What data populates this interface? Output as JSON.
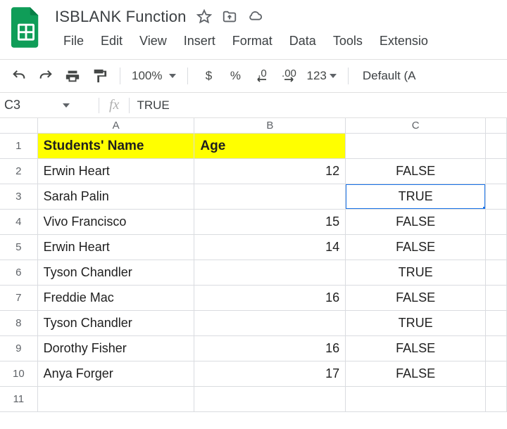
{
  "doc": {
    "title": "ISBLANK Function"
  },
  "menu": {
    "file": "File",
    "edit": "Edit",
    "view": "View",
    "insert": "Insert",
    "format": "Format",
    "data": "Data",
    "tools": "Tools",
    "extensions": "Extensio"
  },
  "toolbar": {
    "zoom": "100%",
    "currency": "$",
    "percent": "%",
    "dec_dec": ".0",
    "dec_inc": ".00",
    "numfmt": "123",
    "font": "Default (A"
  },
  "namebox": {
    "ref": "C3"
  },
  "formula": {
    "value": "TRUE"
  },
  "columns": {
    "A": "A",
    "B": "B",
    "C": "C"
  },
  "headers": {
    "col_a": "Students' Name",
    "col_b": "Age"
  },
  "rows": [
    {
      "n": "1"
    },
    {
      "n": "2",
      "name": "Erwin Heart",
      "age": "12",
      "result": "FALSE"
    },
    {
      "n": "3",
      "name": "Sarah Palin",
      "age": "",
      "result": "TRUE"
    },
    {
      "n": "4",
      "name": "Vivo Francisco",
      "age": "15",
      "result": "FALSE"
    },
    {
      "n": "5",
      "name": "Erwin Heart",
      "age": "14",
      "result": "FALSE"
    },
    {
      "n": "6",
      "name": "Tyson Chandler",
      "age": "",
      "result": "TRUE"
    },
    {
      "n": "7",
      "name": "Freddie Mac",
      "age": "16",
      "result": "FALSE"
    },
    {
      "n": "8",
      "name": "Tyson Chandler",
      "age": "",
      "result": "TRUE"
    },
    {
      "n": "9",
      "name": "Dorothy Fisher",
      "age": "16",
      "result": "FALSE"
    },
    {
      "n": "10",
      "name": "Anya Forger",
      "age": "17",
      "result": "FALSE"
    },
    {
      "n": "11"
    }
  ]
}
